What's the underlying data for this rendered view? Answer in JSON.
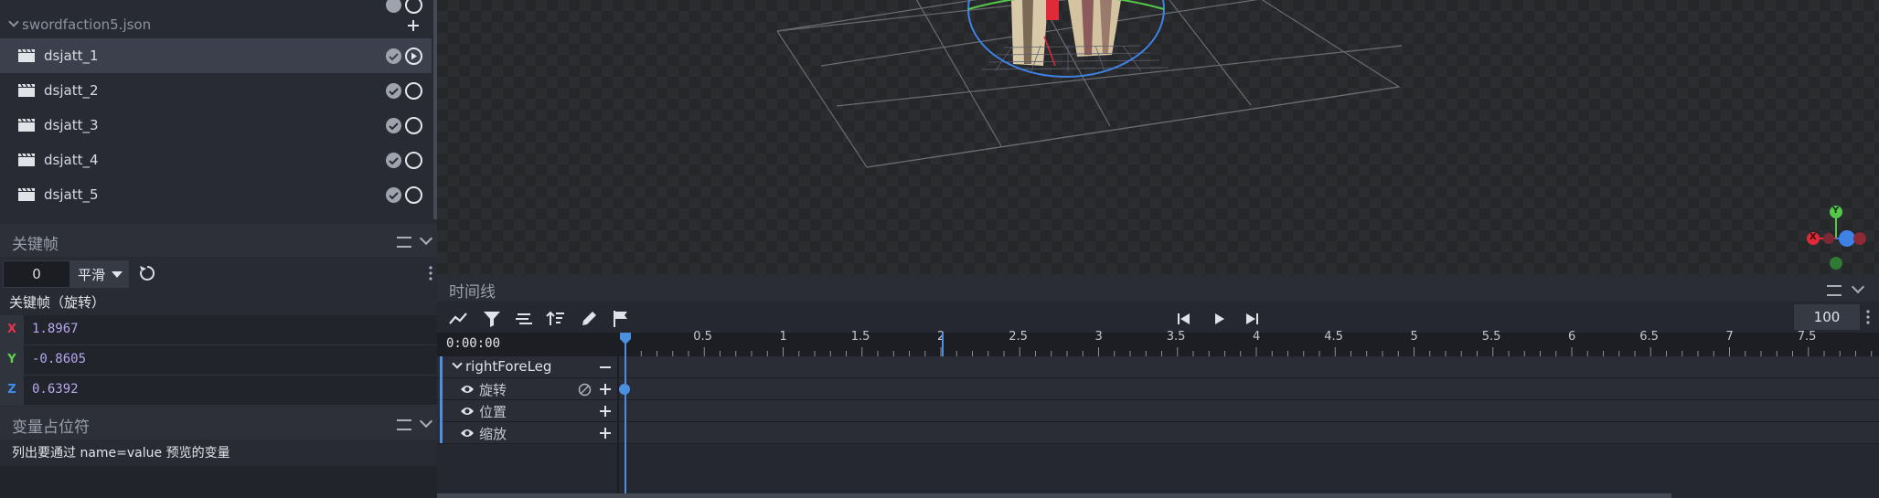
{
  "animations": {
    "file_name": "swordfaction5.json",
    "items": [
      {
        "label": "dsjatt_1",
        "selected": true
      },
      {
        "label": "dsjatt_2",
        "selected": false
      },
      {
        "label": "dsjatt_3",
        "selected": false
      },
      {
        "label": "dsjatt_4",
        "selected": false
      },
      {
        "label": "dsjatt_5",
        "selected": false
      }
    ]
  },
  "keyframe_panel": {
    "title": "关键帧",
    "time_value": "0",
    "interpolation": "平滑",
    "channel_label": "关键帧（旋转）",
    "axes": [
      {
        "axis": "X",
        "value": "1.8967",
        "color": "#e4344a"
      },
      {
        "axis": "Y",
        "value": "-0.8605",
        "color": "#5ed24a"
      },
      {
        "axis": "Z",
        "value": "0.6392",
        "color": "#3e8df0"
      }
    ]
  },
  "variables_panel": {
    "title": "变量占位符",
    "description": "列出要通过 name=value 预览的变量"
  },
  "viewport": {
    "gizmo_labels": {
      "y": "Y",
      "x": "X"
    }
  },
  "timeline": {
    "title": "时间线",
    "time_display": "0:00:00",
    "zoom_value": "100",
    "ruler": [
      "0.5",
      "1",
      "1.5",
      "2",
      "2.5",
      "3",
      "3.5",
      "4",
      "4.5",
      "5",
      "5.5",
      "6",
      "6.5",
      "7",
      "7.5"
    ],
    "bone": "rightForeLeg",
    "channels": [
      "旋转",
      "位置",
      "缩放"
    ]
  },
  "colors": {
    "accent": "#4a8fe0",
    "panel_bg": "#282b33",
    "selected_row": "#3b404c"
  }
}
